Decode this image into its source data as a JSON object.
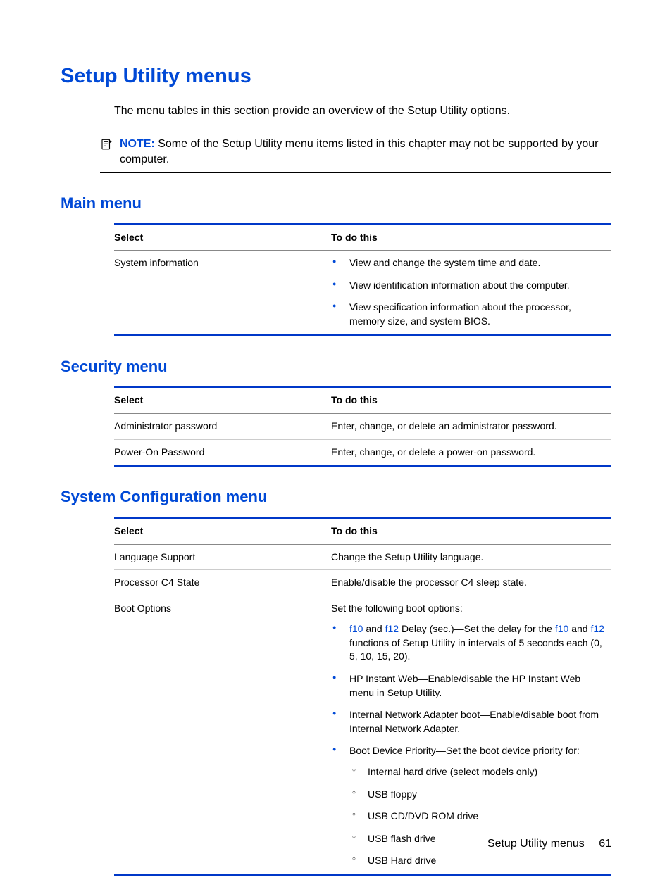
{
  "title": "Setup Utility menus",
  "intro": "The menu tables in this section provide an overview of the Setup Utility options.",
  "note": {
    "label": "NOTE:",
    "text": "Some of the Setup Utility menu items listed in this chapter may not be supported by your computer."
  },
  "sections": {
    "main": {
      "heading": "Main menu",
      "headers": {
        "select": "Select",
        "todo": "To do this"
      },
      "rows": [
        {
          "select": "System information",
          "bullets": [
            "View and change the system time and date.",
            "View identification information about the computer.",
            "View specification information about the processor, memory size, and system BIOS."
          ]
        }
      ]
    },
    "security": {
      "heading": "Security menu",
      "headers": {
        "select": "Select",
        "todo": "To do this"
      },
      "rows": [
        {
          "select": "Administrator password",
          "todo": "Enter, change, or delete an administrator password."
        },
        {
          "select": "Power-On Password",
          "todo": "Enter, change, or delete a power-on password."
        }
      ]
    },
    "sysconfig": {
      "heading": "System Configuration menu",
      "headers": {
        "select": "Select",
        "todo": "To do this"
      },
      "rows": [
        {
          "select": "Language Support",
          "todo": "Change the Setup Utility language."
        },
        {
          "select": "Processor C4 State",
          "todo": "Enable/disable the processor C4 sleep state."
        },
        {
          "select": "Boot Options",
          "intro": "Set the following boot options:",
          "bullets": {
            "b0": {
              "k0": "f10",
              "t0": " and ",
              "k1": "f12",
              "t1": " Delay (sec.)—Set the delay for the ",
              "k2": "f10",
              "t2": " and ",
              "k3": "f12",
              "t3": " functions of Setup Utility in intervals of 5 seconds each (0, 5, 10, 15, 20)."
            },
            "b1": "HP Instant Web—Enable/disable the HP Instant Web menu in Setup Utility.",
            "b2": "Internal Network Adapter boot—Enable/disable boot from Internal Network Adapter.",
            "b3": {
              "text": "Boot Device Priority—Set the boot device priority for:",
              "sub": [
                "Internal hard drive (select models only)",
                "USB floppy",
                "USB CD/DVD ROM drive",
                "USB flash drive",
                "USB Hard drive"
              ]
            }
          }
        }
      ]
    }
  },
  "footer": {
    "label": "Setup Utility menus",
    "page": "61"
  }
}
